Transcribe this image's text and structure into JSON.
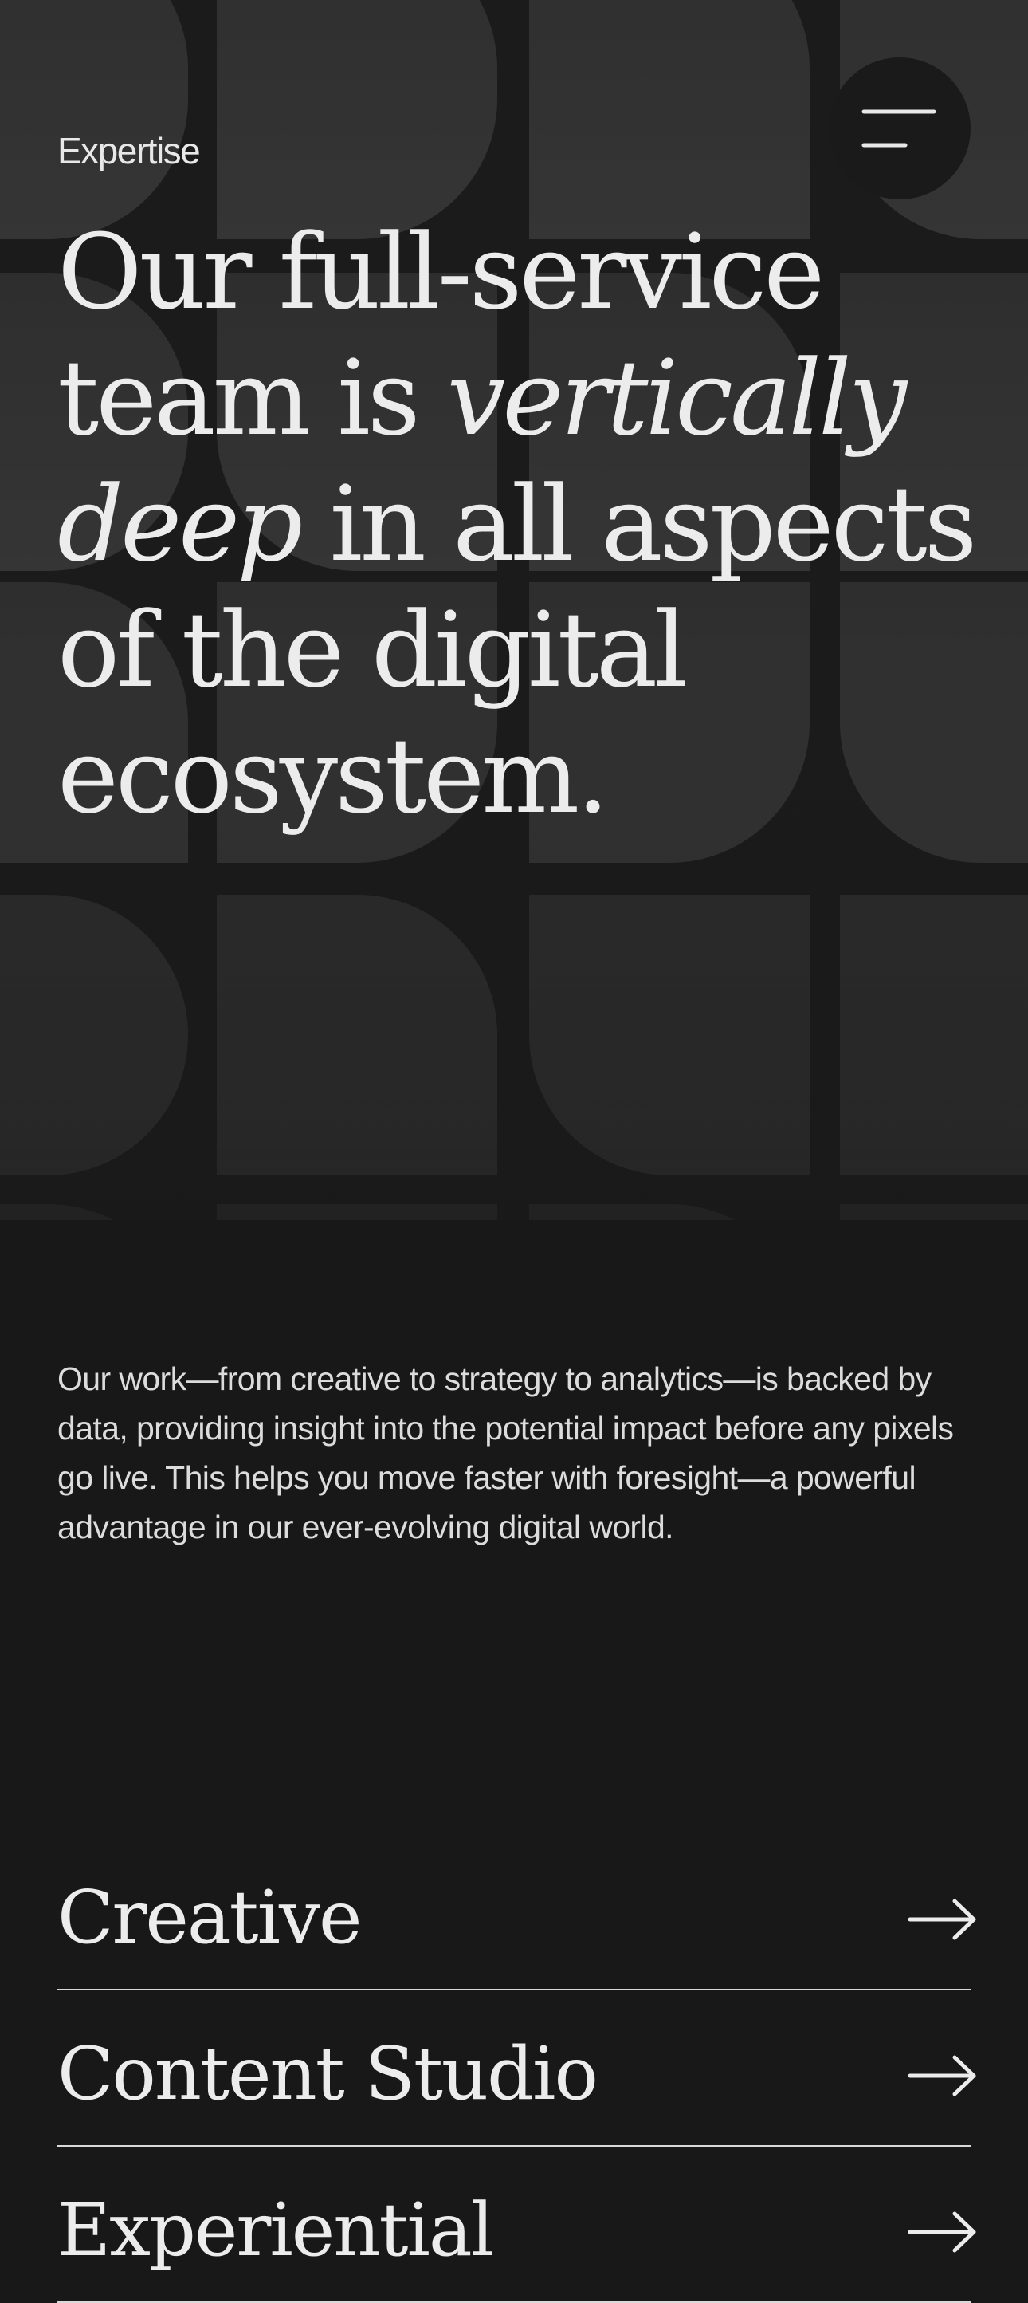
{
  "header": {
    "section_label": "Expertise",
    "menu_icon": "hamburger-menu-icon"
  },
  "hero": {
    "headline_part1": "Our full-service team is ",
    "headline_italic": "vertically deep",
    "headline_part2": " in all aspects of the digital ecosystem."
  },
  "intro": {
    "text": "Our work—from creative to strategy to analytics—is backed by data, providing insight into the potential impact before any pixels go live. This helps you move faster with foresight—a powerful advantage in our ever-evolving digital world."
  },
  "services": {
    "items": [
      {
        "label": "Creative",
        "icon": "arrow-right-icon"
      },
      {
        "label": "Content Studio",
        "icon": "arrow-right-icon"
      },
      {
        "label": "Experiential",
        "icon": "arrow-right-icon"
      }
    ]
  },
  "colors": {
    "background": "#181818",
    "pattern_shape": "#303030",
    "text": "#ececec",
    "divider": "#d9d9d9"
  }
}
